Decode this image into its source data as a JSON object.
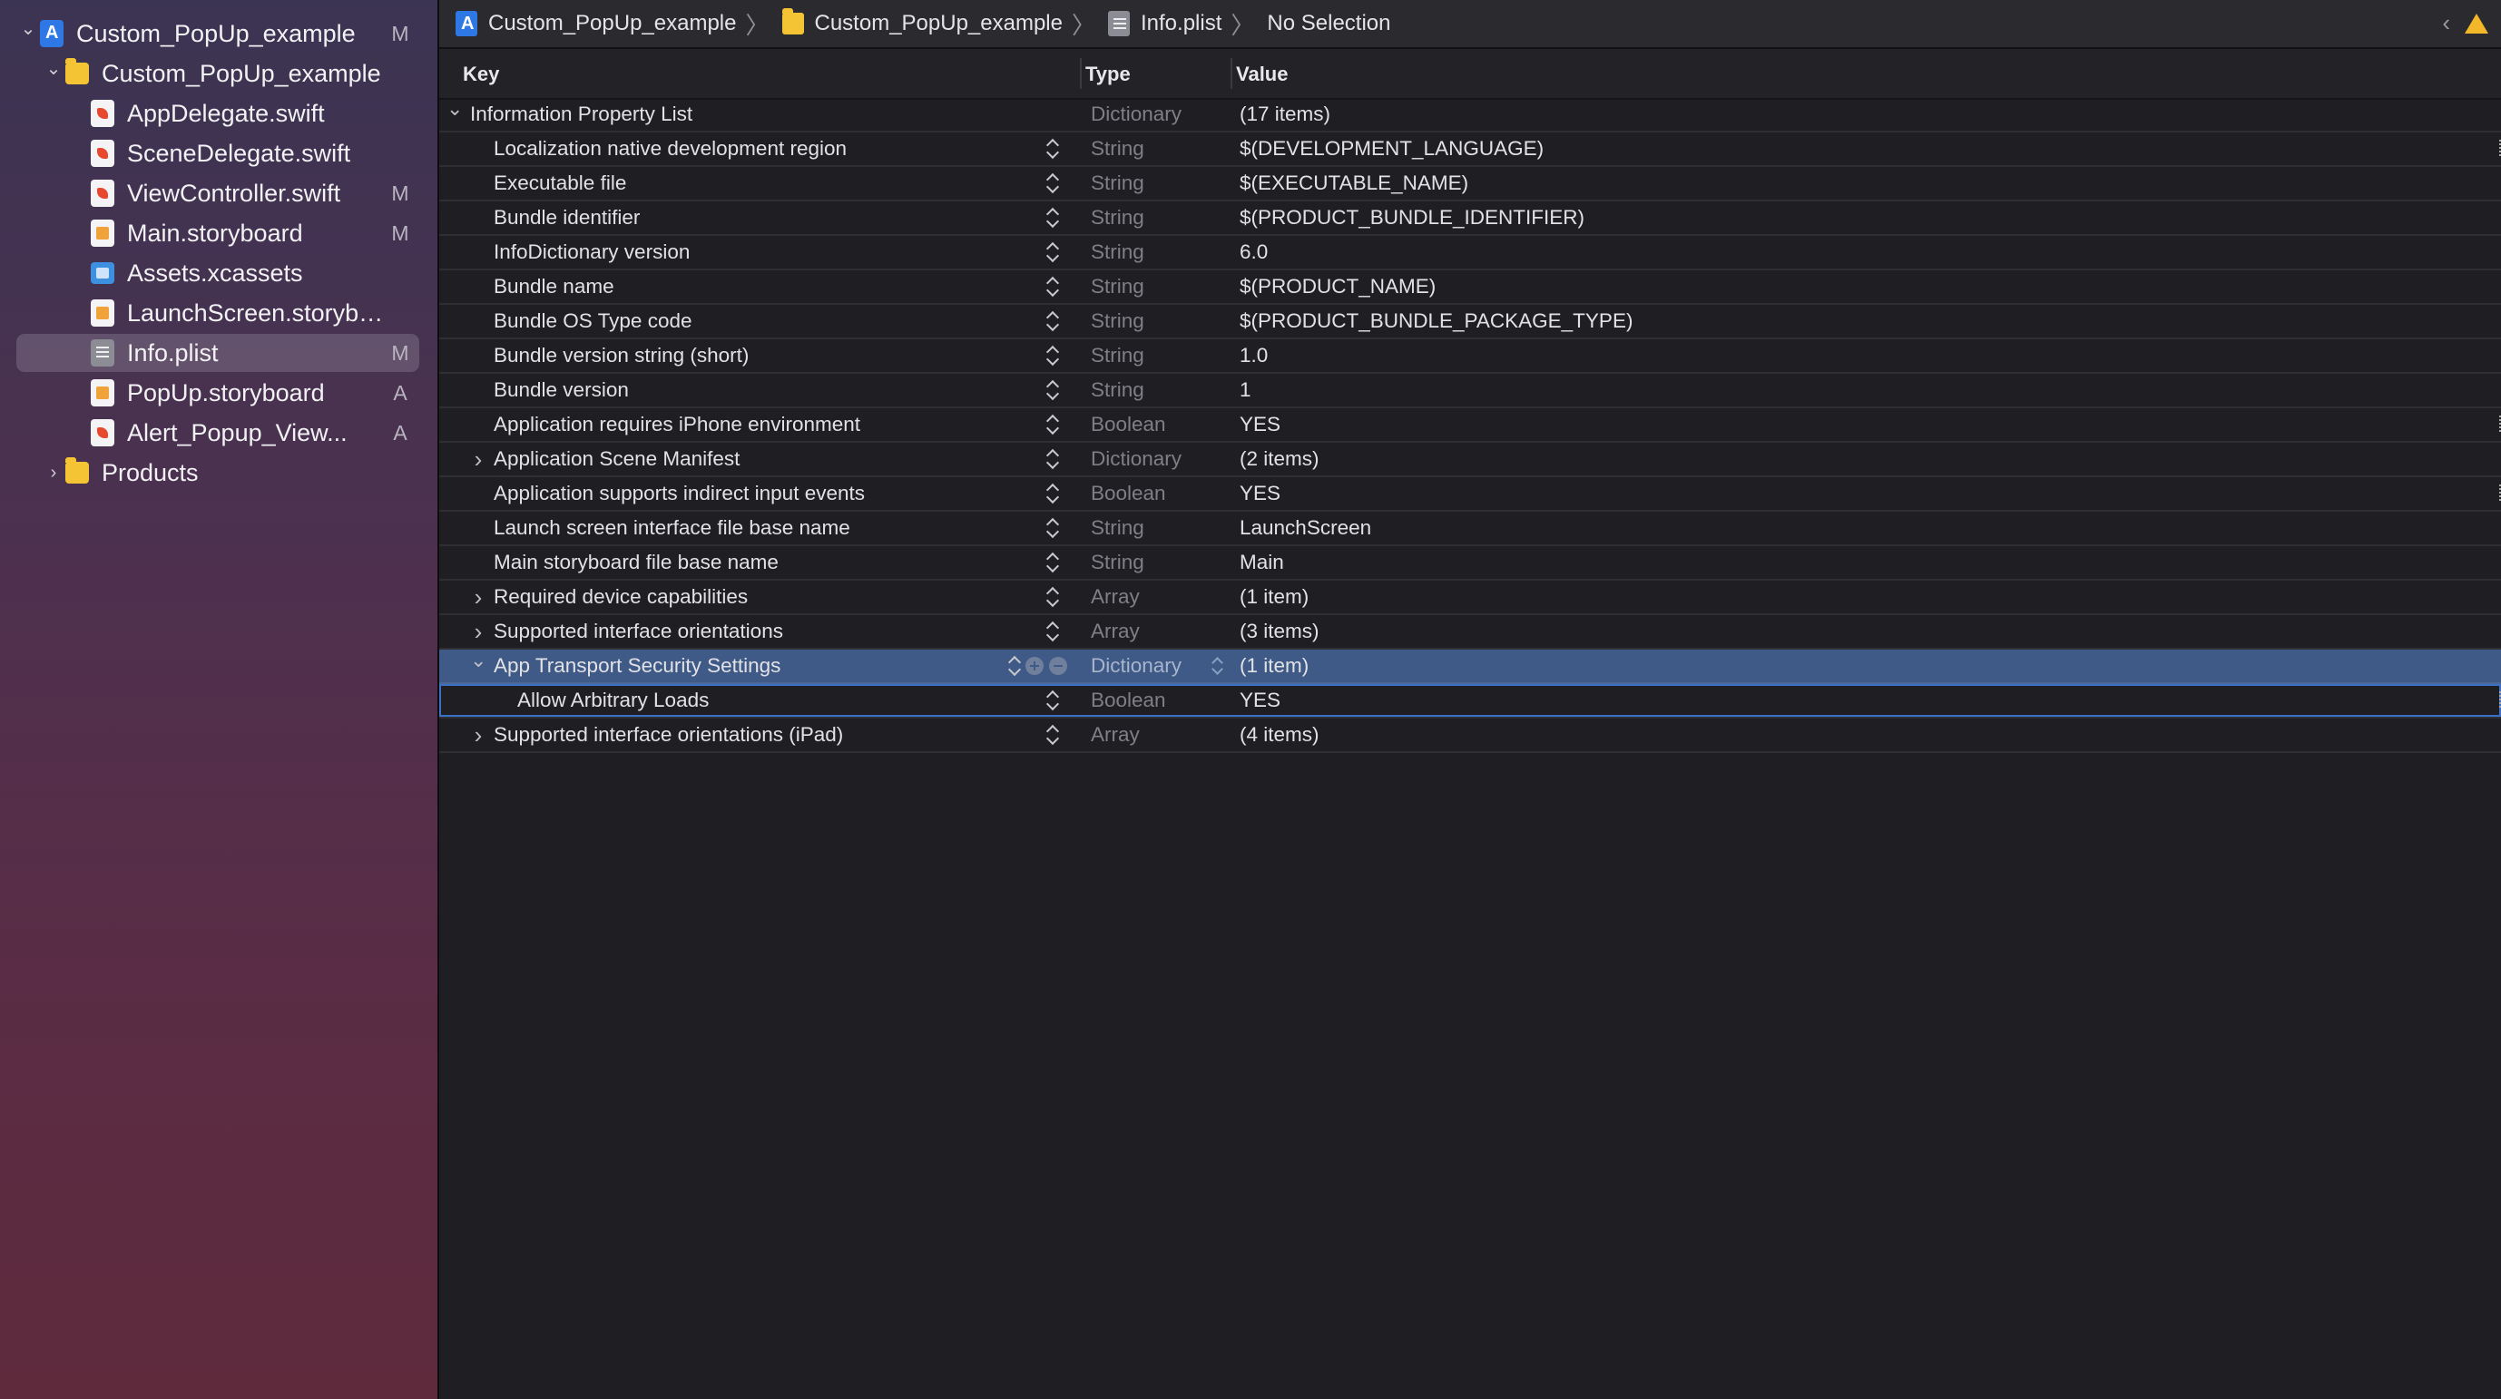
{
  "navigator": {
    "items": [
      {
        "label": "Custom_PopUp_example",
        "badge": "M",
        "icon": "project-icon",
        "disclosure": "expanded"
      },
      {
        "label": "Custom_PopUp_example",
        "badge": "",
        "icon": "folder-icon",
        "disclosure": "expanded"
      },
      {
        "label": "AppDelegate.swift",
        "badge": "",
        "icon": "swift-file-icon",
        "disclosure": ""
      },
      {
        "label": "SceneDelegate.swift",
        "badge": "",
        "icon": "swift-file-icon",
        "disclosure": ""
      },
      {
        "label": "ViewController.swift",
        "badge": "M",
        "icon": "swift-file-icon",
        "disclosure": ""
      },
      {
        "label": "Main.storyboard",
        "badge": "M",
        "icon": "storyboard-file-icon",
        "disclosure": ""
      },
      {
        "label": "Assets.xcassets",
        "badge": "",
        "icon": "asset-catalog-icon",
        "disclosure": ""
      },
      {
        "label": "LaunchScreen.storybo...",
        "badge": "",
        "icon": "storyboard-file-icon",
        "disclosure": ""
      },
      {
        "label": "Info.plist",
        "badge": "M",
        "icon": "plist-file-icon",
        "disclosure": "",
        "selected": true
      },
      {
        "label": "PopUp.storyboard",
        "badge": "A",
        "icon": "storyboard-file-icon",
        "disclosure": ""
      },
      {
        "label": "Alert_Popup_View...",
        "badge": "A",
        "icon": "swift-file-icon",
        "disclosure": ""
      },
      {
        "label": "Products",
        "badge": "",
        "icon": "folder-icon",
        "disclosure": "collapsed"
      }
    ]
  },
  "jumpbar": {
    "crumbs": [
      {
        "label": "Custom_PopUp_example",
        "icon": "project-icon"
      },
      {
        "label": "Custom_PopUp_example",
        "icon": "folder-icon"
      },
      {
        "label": "Info.plist",
        "icon": "plist-file-icon"
      },
      {
        "label": "No Selection",
        "icon": ""
      }
    ]
  },
  "plist": {
    "headers": {
      "key": "Key",
      "type": "Type",
      "value": "Value"
    },
    "rows": [
      {
        "key": "Information Property List",
        "type": "Dictionary",
        "value": "(17 items)",
        "level": 0,
        "disclosure": "expanded"
      },
      {
        "key": "Localization native development region",
        "type": "String",
        "value": "$(DEVELOPMENT_LANGUAGE)",
        "level": 1,
        "disclosure": ""
      },
      {
        "key": "Executable file",
        "type": "String",
        "value": "$(EXECUTABLE_NAME)",
        "level": 1,
        "disclosure": ""
      },
      {
        "key": "Bundle identifier",
        "type": "String",
        "value": "$(PRODUCT_BUNDLE_IDENTIFIER)",
        "level": 1,
        "disclosure": ""
      },
      {
        "key": "InfoDictionary version",
        "type": "String",
        "value": "6.0",
        "level": 1,
        "disclosure": ""
      },
      {
        "key": "Bundle name",
        "type": "String",
        "value": "$(PRODUCT_NAME)",
        "level": 1,
        "disclosure": ""
      },
      {
        "key": "Bundle OS Type code",
        "type": "String",
        "value": "$(PRODUCT_BUNDLE_PACKAGE_TYPE)",
        "level": 1,
        "disclosure": ""
      },
      {
        "key": "Bundle version string (short)",
        "type": "String",
        "value": "1.0",
        "level": 1,
        "disclosure": ""
      },
      {
        "key": "Bundle version",
        "type": "String",
        "value": "1",
        "level": 1,
        "disclosure": ""
      },
      {
        "key": "Application requires iPhone environment",
        "type": "Boolean",
        "value": "YES",
        "level": 1,
        "disclosure": ""
      },
      {
        "key": "Application Scene Manifest",
        "type": "Dictionary",
        "value": "(2 items)",
        "level": 1,
        "disclosure": "collapsed"
      },
      {
        "key": "Application supports indirect input events",
        "type": "Boolean",
        "value": "YES",
        "level": 1,
        "disclosure": ""
      },
      {
        "key": "Launch screen interface file base name",
        "type": "String",
        "value": "LaunchScreen",
        "level": 1,
        "disclosure": ""
      },
      {
        "key": "Main storyboard file base name",
        "type": "String",
        "value": "Main",
        "level": 1,
        "disclosure": ""
      },
      {
        "key": "Required device capabilities",
        "type": "Array",
        "value": "(1 item)",
        "level": 1,
        "disclosure": "collapsed"
      },
      {
        "key": "Supported interface orientations",
        "type": "Array",
        "value": "(3 items)",
        "level": 1,
        "disclosure": "collapsed"
      },
      {
        "key": "App Transport Security Settings",
        "type": "Dictionary",
        "value": "(1 item)",
        "level": 1,
        "disclosure": "expanded",
        "selected": true
      },
      {
        "key": "Allow Arbitrary Loads",
        "type": "Boolean",
        "value": "YES",
        "level": 2,
        "disclosure": "",
        "editing": true
      },
      {
        "key": "Supported interface orientations (iPad)",
        "type": "Array",
        "value": "(4 items)",
        "level": 1,
        "disclosure": "collapsed"
      }
    ]
  },
  "colors": {
    "selection": "#3f5a86",
    "sidebar_selection": "rgba(255,255,255,0.16)",
    "warning": "#f3b72a"
  }
}
